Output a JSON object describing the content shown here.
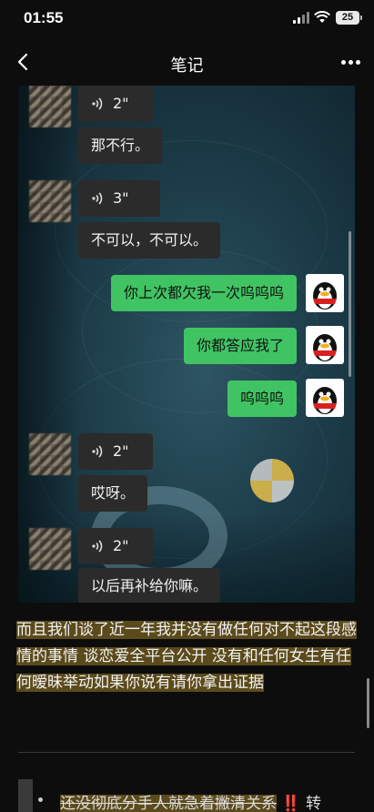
{
  "status_bar": {
    "time": "01:55",
    "battery": "25"
  },
  "nav": {
    "title": "笔记"
  },
  "chat": {
    "messages": [
      {
        "side": "left",
        "type": "voice",
        "duration": "2\""
      },
      {
        "side": "left",
        "type": "text",
        "text": "那不行。"
      },
      {
        "side": "left",
        "type": "voice",
        "duration": "3\""
      },
      {
        "side": "left",
        "type": "text",
        "text": "不可以，不可以。"
      },
      {
        "side": "right",
        "type": "text",
        "text": "你上次都欠我一次呜呜呜"
      },
      {
        "side": "right",
        "type": "text",
        "text": "你都答应我了"
      },
      {
        "side": "right",
        "type": "text",
        "text": "呜呜呜"
      },
      {
        "side": "left",
        "type": "voice",
        "duration": "2\""
      },
      {
        "side": "left",
        "type": "text",
        "text": "哎呀。"
      },
      {
        "side": "left",
        "type": "voice",
        "duration": "2\""
      },
      {
        "side": "left",
        "type": "text",
        "text": "以后再补给你嘛。"
      }
    ]
  },
  "note": {
    "paragraph": "而且我们谈了近一年我并没有做任何对不起这段感情的事情 谈恋爱全平台公开 没有和任何女生有任何暧昧举动如果你说有请你拿出证据"
  },
  "bottom": {
    "strike_text": "还没彻底分手人就急着撇清关系",
    "warn": "‼️",
    "tail": "转"
  },
  "colors": {
    "highlight": "#5b4a1c",
    "green_bubble": "#40c463",
    "dark_bubble": "#2b2b2b"
  }
}
